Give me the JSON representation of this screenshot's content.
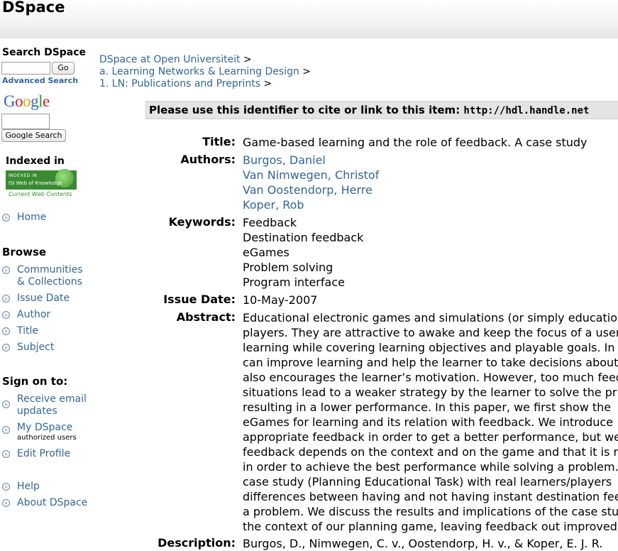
{
  "header": {
    "logo": "DSpace"
  },
  "sidebar": {
    "search_heading": "Search DSpace",
    "go_label": "Go",
    "advanced_search": "Advanced Search",
    "google_logo": "Google",
    "google_search_label": "Google Search",
    "indexed_in": "Indexed in",
    "isi_badge": {
      "line1": "INDEXED IN",
      "line2": "ISI Web of Knowledge",
      "line3": "Current Web Contents"
    },
    "home": "Home",
    "browse_heading": "Browse",
    "browse_items": [
      "Communities",
      "& Collections",
      "Issue Date",
      "Author",
      "Title",
      "Subject"
    ],
    "sign_on_heading": "Sign on to:",
    "receive_email_1": "Receive email",
    "receive_email_2": "updates",
    "my_dspace": "My DSpace",
    "authorized_users": "authorized users",
    "edit_profile": "Edit Profile",
    "help": "Help",
    "about": "About DSpace"
  },
  "breadcrumbs": [
    "DSpace at Open Universiteit",
    "a. Learning Networks & Learning Design",
    "1. LN: Publications and Preprints"
  ],
  "breadcrumb_sep": ">",
  "cite": {
    "text": "Please use this identifier to cite or link to this item: ",
    "url": "http://hdl.handle.net"
  },
  "item": {
    "title_label": "Title:",
    "title": "Game-based learning and the role of feedback. A case study",
    "authors_label": "Authors:",
    "authors": [
      "Burgos, Daniel",
      "Van Nimwegen, Christof",
      "Van Oostendorp, Herre",
      "Koper, Rob"
    ],
    "keywords_label": "Keywords:",
    "keywords": [
      "Feedback",
      "Destination feedback",
      "eGames",
      "Problem solving",
      "Program interface"
    ],
    "issue_date_label": "Issue Date:",
    "issue_date": "10-May-2007",
    "abstract_label": "Abstract:",
    "abstract_lines": [
      "Educational electronic games and simulations (or simply educational",
      "players. They are attractive to awake and keep the focus of a user",
      "learning while covering learning objectives and playable goals. In",
      "can improve learning and help the learner to take decisions about",
      "also encourages the learner’s motivation. However, too much feed",
      "situations lead to a weaker strategy by the learner to solve the pr",
      "resulting in a lower performance. In this paper, we first show the",
      "eGames for learning and its relation with feedback. We introduce",
      "appropriate feedback in order to get a better performance, but we",
      "feedback depends on the context and on the game and that it is n",
      "in order to achieve the best performance while solving a problem.",
      "case study (Planning Educational Task) with real learners/players",
      "differences between having and not having instant destination fee",
      "a problem. We discuss the results and implications of the case stu",
      "the context of our planning game, leaving feedback out improved"
    ],
    "description_label": "Description:",
    "description": "Burgos, D., Nimwegen, C. v., Oostendorp, H. v., & Koper, E. J. R."
  }
}
